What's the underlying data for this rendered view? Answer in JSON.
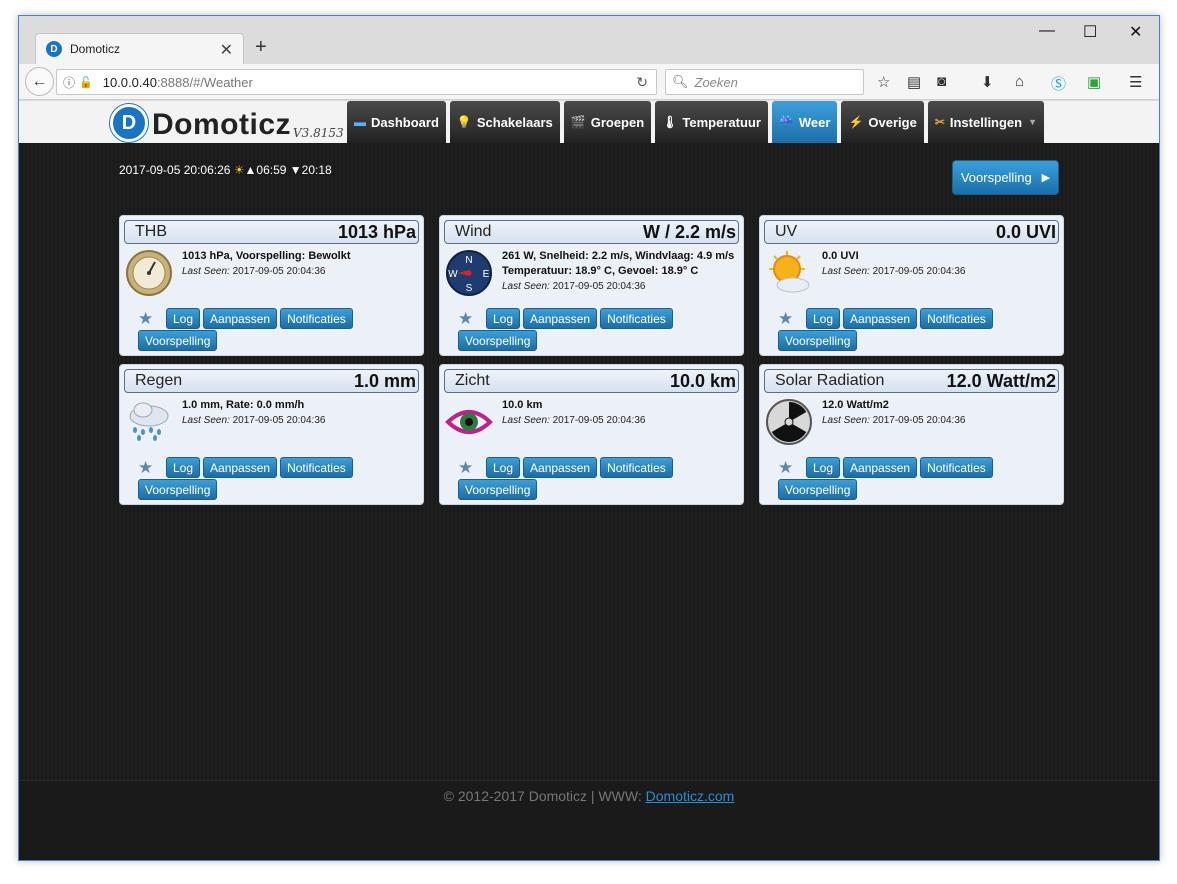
{
  "browser": {
    "tab_title": "Domoticz",
    "new_tab": "+",
    "url_host": "10.0.0.40",
    "url_rest": ":8888/#/Weather",
    "search_placeholder": "Zoeken",
    "minimize": "—",
    "maximize": "☐",
    "close": "✕"
  },
  "app": {
    "logo_text": "Domoticz",
    "version": "V3.8153",
    "menu": [
      {
        "label": "Dashboard",
        "icon": "▬"
      },
      {
        "label": "Schakelaars",
        "icon": "💡"
      },
      {
        "label": "Groepen",
        "icon": "🎬"
      },
      {
        "label": "Temperatuur",
        "icon": "🌡"
      },
      {
        "label": "Weer",
        "icon": "☔"
      },
      {
        "label": "Overige",
        "icon": "⚡"
      },
      {
        "label": "Instellingen",
        "icon": "✂"
      }
    ],
    "datetime": "2017-09-05 20:06:26",
    "sunrise": "▲06:59",
    "sunset": "▼20:18",
    "forecast_button": "Voorspelling"
  },
  "cards": [
    {
      "name": "THB",
      "value": "1013 hPa",
      "desc": "1013 hPa, Voorspelling: Bewolkt",
      "last_seen_label": "Last Seen:",
      "last_seen": "2017-09-05 20:04:36",
      "icon": "barometer-icon"
    },
    {
      "name": "Wind",
      "value": "W / 2.2 m/s",
      "desc": "261 W, Snelheid: 2.2 m/s, Windvlaag: 4.9 m/s",
      "desc2": "Temperatuur: 18.9° C, Gevoel: 18.9° C",
      "last_seen_label": "Last Seen:",
      "last_seen": "2017-09-05 20:04:36",
      "icon": "compass-icon"
    },
    {
      "name": "UV",
      "value": "0.0 UVI",
      "desc": "0.0 UVI",
      "last_seen_label": "Last Seen:",
      "last_seen": "2017-09-05 20:04:36",
      "icon": "sun-icon"
    },
    {
      "name": "Regen",
      "value": "1.0 mm",
      "desc": "1.0 mm, Rate: 0.0 mm/h",
      "last_seen_label": "Last Seen:",
      "last_seen": "2017-09-05 20:04:36",
      "icon": "rain-cloud-icon"
    },
    {
      "name": "Zicht",
      "value": "10.0 km",
      "desc": "10.0 km",
      "last_seen_label": "Last Seen:",
      "last_seen": "2017-09-05 20:04:36",
      "icon": "eye-icon"
    },
    {
      "name": "Solar Radiation",
      "value": "12.0 Watt/m2",
      "desc": "12.0 Watt/m2",
      "last_seen_label": "Last Seen:",
      "last_seen": "2017-09-05 20:04:36",
      "icon": "radiation-icon"
    }
  ],
  "card_buttons": {
    "log": "Log",
    "edit": "Aanpassen",
    "notify": "Notificaties",
    "forecast": "Voorspelling"
  },
  "footer": {
    "text": "© 2012-2017 Domoticz | WWW: ",
    "link": "Domoticz.com"
  }
}
